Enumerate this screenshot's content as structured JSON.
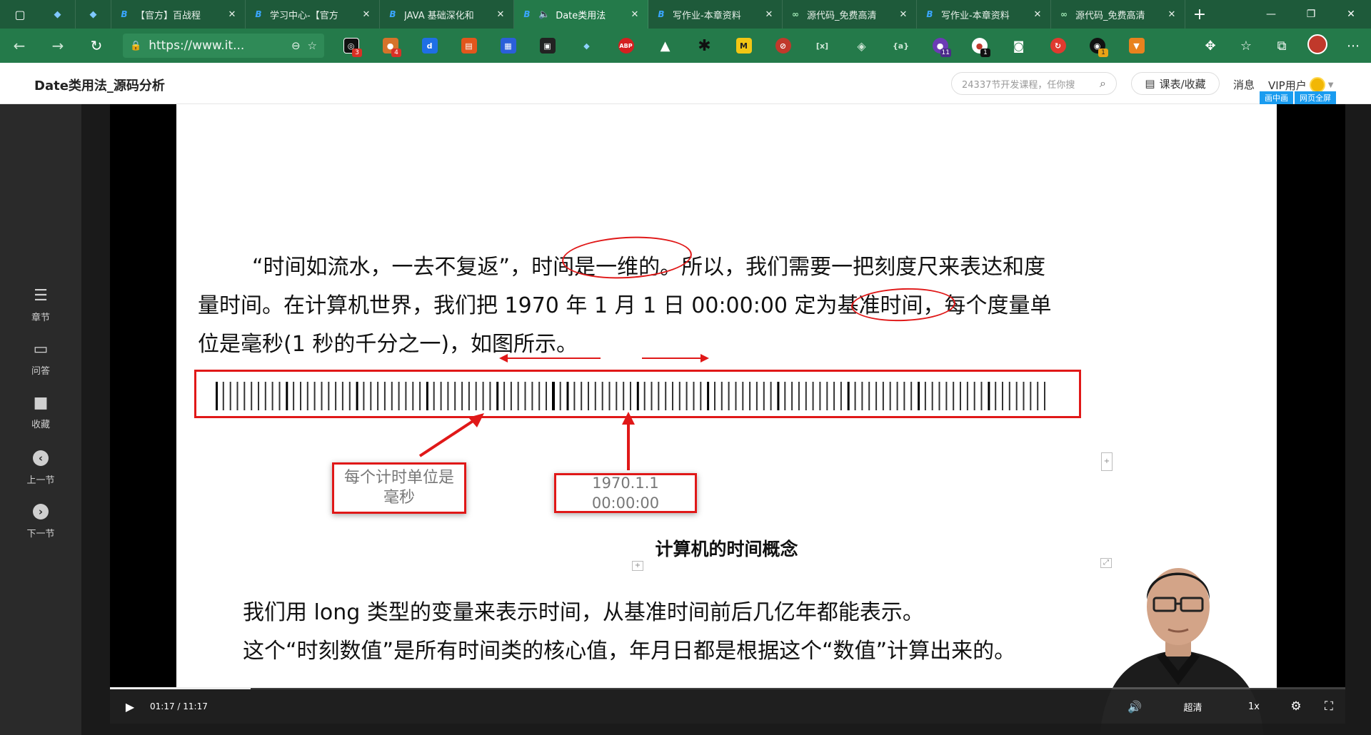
{
  "browser": {
    "tabs": [
      {
        "title": "【官方】百战程",
        "active": false
      },
      {
        "title": "学习中心-【官方",
        "active": false
      },
      {
        "title": "JAVA 基础深化和",
        "active": false
      },
      {
        "title": "Date类用法",
        "active": true
      },
      {
        "title": "写作业-本章资料",
        "active": false
      },
      {
        "title": "源代码_免费高清",
        "active": false
      },
      {
        "title": "写作业-本章资料",
        "active": false
      },
      {
        "title": "源代码_免费高清",
        "active": false
      }
    ],
    "url": "https://www.it...",
    "extension_badges": [
      "3",
      "4",
      "11",
      "1",
      "1"
    ]
  },
  "header": {
    "page_title": "Date类用法_源码分析",
    "search_placeholder": "24337节开发课程，任你搜",
    "course_button": "课表/收藏",
    "messages": "消息",
    "vip": "VIP用户",
    "pip_button": "画中画",
    "fullpage_button": "网页全屏"
  },
  "sidebar": {
    "items": [
      {
        "label": "章节",
        "icon": "chapters-icon"
      },
      {
        "label": "问答",
        "icon": "qa-icon"
      },
      {
        "label": "收藏",
        "icon": "bookmark-icon"
      },
      {
        "label": "上一节",
        "icon": "prev-icon"
      },
      {
        "label": "下一节",
        "icon": "next-icon"
      }
    ]
  },
  "slide": {
    "para1_line1": "“时间如流水，一去不复返”，时间是一维的。所以，我们需要一把刻度尺来表达和度",
    "para1_line2": "量时间。在计算机世界，我们把 1970  年  1  月  1  日  00:00:00 定为基准时间，每个度量单",
    "para1_line3": "位是毫秒(1 秒的千分之一)，如图所示。",
    "label_unit": "每个计时单位是毫秒",
    "label_epoch": "1970.1.1 00:00:00",
    "caption": "计算机的时间概念",
    "para2_line1": "我们用 long 类型的变量来表示时间，从基准时间前后几亿年都能表示。",
    "para2_line2": "这个“时刻数值”是所有时间类的核心值，年月日都是根据这个“数值”计算出来的。"
  },
  "player": {
    "current_time": "01:17",
    "duration": "11:17",
    "progress_fraction": 0.114,
    "quality": "超清",
    "speed": "1x"
  },
  "colors": {
    "browser_chrome": "#247a4a",
    "annotation_red": "#e01818",
    "pip_blue": "#1a9cf0"
  }
}
